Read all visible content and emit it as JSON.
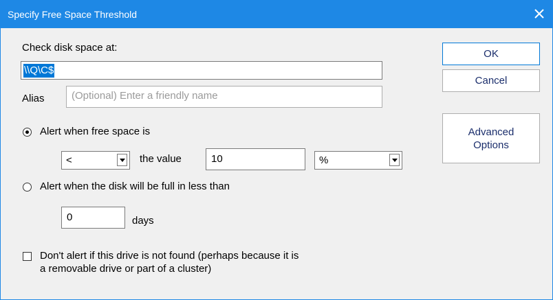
{
  "window": {
    "title": "Specify Free Space Threshold"
  },
  "form": {
    "check_label": "Check disk space at:",
    "path_value": "\\\\Q\\C$",
    "alias_label": "Alias",
    "alias_placeholder": "(Optional) Enter a friendly name",
    "radio_free_space_label": "Alert when free space is",
    "operator_value": "<",
    "the_value_label": "the value",
    "threshold_value": "10",
    "unit_value": "%",
    "radio_full_label": "Alert when the disk will be full in less than",
    "days_value": "0",
    "days_label": "days",
    "not_found_line1": "Don't alert if this drive is not found (perhaps because it is",
    "not_found_line2": "a removable drive or part of a cluster)"
  },
  "buttons": {
    "ok": "OK",
    "cancel": "Cancel",
    "advanced_line1": "Advanced",
    "advanced_line2": "Options"
  },
  "state": {
    "radio_free_space_checked": true,
    "radio_full_checked": false,
    "not_found_checked": false
  },
  "colors": {
    "accent": "#1e88e5",
    "selection": "#0078d7",
    "dialog_bg": "#f0f0f0"
  }
}
